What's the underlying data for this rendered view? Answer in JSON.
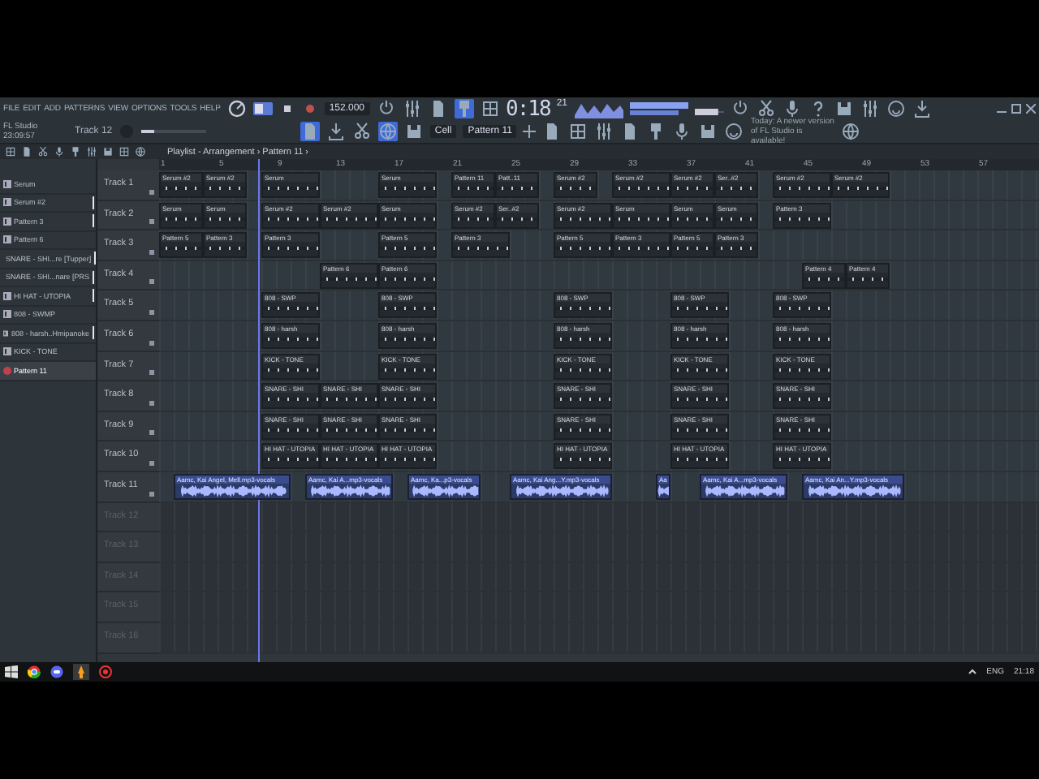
{
  "menu": [
    "FILE",
    "EDIT",
    "ADD",
    "PATTERNS",
    "VIEW",
    "OPTIONS",
    "TOOLS",
    "HELP"
  ],
  "hint": {
    "title": "FL Studio",
    "value": "23:09:57",
    "target": "Track 12"
  },
  "transport": {
    "tempo": "152.000",
    "time": "0:18",
    "time_fraction": "21",
    "pattern": "Pattern 11",
    "snap": "Cell",
    "recording": false,
    "volume": {
      "level": 0.8
    },
    "pitch": {
      "level": 0.2
    }
  },
  "news": "Today: A newer version of FL Studio is available!",
  "playlist": {
    "title": "Playlist - Arrangement › Pattern 11 ›",
    "playhead": {
      "level": 0.112
    },
    "ruler": [
      "1",
      "5",
      "9",
      "13",
      "17",
      "21",
      "25",
      "29",
      "33",
      "37",
      "41",
      "45",
      "49",
      "53",
      "57"
    ],
    "tracks": [
      {
        "name": "Track 1",
        "dimmed": false,
        "clips": [
          {
            "kind": "pattern",
            "label": "Serum #2"
          },
          {
            "kind": "pattern",
            "label": "Serum #2"
          },
          {
            "kind": "pattern",
            "label": "Serum"
          },
          {
            "kind": "pattern",
            "label": "Serum"
          },
          {
            "kind": "pattern",
            "label": "Pattern 11"
          },
          {
            "kind": "pattern",
            "label": "Patt..11"
          },
          {
            "kind": "pattern",
            "label": "Serum #2"
          },
          {
            "kind": "pattern",
            "label": "Serum #2"
          },
          {
            "kind": "pattern",
            "label": "Serum #2"
          },
          {
            "kind": "pattern",
            "label": "Ser..#2"
          },
          {
            "kind": "pattern",
            "label": "Serum #2"
          },
          {
            "kind": "pattern",
            "label": "Serum #2"
          }
        ]
      },
      {
        "name": "Track 2",
        "dimmed": false,
        "clips": [
          {
            "kind": "pattern",
            "label": "Serum"
          },
          {
            "kind": "pattern",
            "label": "Serum"
          },
          {
            "kind": "pattern",
            "label": "Serum #2"
          },
          {
            "kind": "pattern",
            "label": "Serum #2"
          },
          {
            "kind": "pattern",
            "label": "Serum"
          },
          {
            "kind": "pattern",
            "label": "Serum #2"
          },
          {
            "kind": "pattern",
            "label": "Ser..#2"
          },
          {
            "kind": "pattern",
            "label": "Serum #2"
          },
          {
            "kind": "pattern",
            "label": "Serum"
          },
          {
            "kind": "pattern",
            "label": "Serum"
          },
          {
            "kind": "pattern",
            "label": "Serum"
          },
          {
            "kind": "pattern",
            "label": "Pattern 3"
          }
        ]
      },
      {
        "name": "Track 3",
        "dimmed": false,
        "clips": [
          {
            "kind": "pattern",
            "label": "Pattern 5"
          },
          {
            "kind": "pattern",
            "label": "Pattern 3"
          },
          {
            "kind": "pattern",
            "label": "Pattern 3"
          },
          {
            "kind": "pattern",
            "label": "Pattern 5"
          },
          {
            "kind": "pattern",
            "label": "Pattern 3"
          },
          {
            "kind": "pattern",
            "label": "Pattern 5"
          },
          {
            "kind": "pattern",
            "label": "Pattern 3"
          },
          {
            "kind": "pattern",
            "label": "Pattern 5"
          },
          {
            "kind": "pattern",
            "label": "Pattern 3"
          }
        ]
      },
      {
        "name": "Track 4",
        "dimmed": false,
        "clips": [
          {
            "kind": "pattern",
            "label": "Pattern 6"
          },
          {
            "kind": "pattern",
            "label": "Pattern 6"
          },
          {
            "kind": "pattern",
            "label": "Pattern 4"
          },
          {
            "kind": "pattern",
            "label": "Pattern 4"
          }
        ]
      },
      {
        "name": "Track 5",
        "dimmed": false,
        "clips": [
          {
            "kind": "pattern",
            "label": "808 - SWP"
          },
          {
            "kind": "pattern",
            "label": "808 - SWP"
          },
          {
            "kind": "pattern",
            "label": "808 - SWP"
          },
          {
            "kind": "pattern",
            "label": "808 - SWP"
          },
          {
            "kind": "pattern",
            "label": "808 - SWP"
          }
        ]
      },
      {
        "name": "Track 6",
        "dimmed": false,
        "clips": [
          {
            "kind": "pattern",
            "label": "808 - harsh"
          },
          {
            "kind": "pattern",
            "label": "808 - harsh"
          },
          {
            "kind": "pattern",
            "label": "808 - harsh"
          },
          {
            "kind": "pattern",
            "label": "808 - harsh"
          },
          {
            "kind": "pattern",
            "label": "808 - harsh"
          }
        ]
      },
      {
        "name": "Track 7",
        "dimmed": false,
        "clips": [
          {
            "kind": "pattern",
            "label": "KICK - TONE"
          },
          {
            "kind": "pattern",
            "label": "KICK - TONE"
          },
          {
            "kind": "pattern",
            "label": "KICK - TONE"
          },
          {
            "kind": "pattern",
            "label": "KICK - TONE"
          },
          {
            "kind": "pattern",
            "label": "KICK - TONE"
          }
        ]
      },
      {
        "name": "Track 8",
        "dimmed": false,
        "clips": [
          {
            "kind": "pattern",
            "label": "SNARE - SHI"
          },
          {
            "kind": "pattern",
            "label": "SNARE - SHI"
          },
          {
            "kind": "pattern",
            "label": "SNARE - SHI"
          },
          {
            "kind": "pattern",
            "label": "SNARE - SHI"
          },
          {
            "kind": "pattern",
            "label": "SNARE - SHI"
          },
          {
            "kind": "pattern",
            "label": "SNARE - SHI"
          }
        ]
      },
      {
        "name": "Track 9",
        "dimmed": false,
        "clips": [
          {
            "kind": "pattern",
            "label": "SNARE - SHI"
          },
          {
            "kind": "pattern",
            "label": "SNARE - SHI"
          },
          {
            "kind": "pattern",
            "label": "SNARE - SHI"
          },
          {
            "kind": "pattern",
            "label": "SNARE - SHI"
          },
          {
            "kind": "pattern",
            "label": "SNARE - SHI"
          },
          {
            "kind": "pattern",
            "label": "SNARE - SHI"
          }
        ]
      },
      {
        "name": "Track 10",
        "dimmed": false,
        "clips": [
          {
            "kind": "pattern",
            "label": "HI HAT - UTOPIA"
          },
          {
            "kind": "pattern",
            "label": "HI HAT - UTOPIA"
          },
          {
            "kind": "pattern",
            "label": "HI HAT - UTOPIA"
          },
          {
            "kind": "pattern",
            "label": "HI HAT - UTOPIA"
          },
          {
            "kind": "pattern",
            "label": "HI HAT - UTOPIA"
          },
          {
            "kind": "pattern",
            "label": "HI HAT - UTOPIA"
          }
        ]
      },
      {
        "name": "Track 11",
        "dimmed": false,
        "clips": [
          {
            "kind": "audio",
            "label": "Aamc, Kai Angel, Mell.mp3-vocals"
          },
          {
            "kind": "audio",
            "label": "Aamc, Kai A...mp3-vocals"
          },
          {
            "kind": "audio",
            "label": "Aamc, Ka...p3-vocals"
          },
          {
            "kind": "audio",
            "label": "Aamc, Kai Ang...Y.mp3-vocals"
          },
          {
            "kind": "audio",
            "label": "Aa"
          },
          {
            "kind": "audio",
            "label": "Aamc, Kai A...mp3-vocals"
          },
          {
            "kind": "audio",
            "label": "Aamc, Kai An...Y.mp3-vocals"
          }
        ]
      },
      {
        "name": "Track 12",
        "dimmed": true
      },
      {
        "name": "Track 13",
        "dimmed": true
      },
      {
        "name": "Track 14",
        "dimmed": true
      },
      {
        "name": "Track 15",
        "dimmed": true
      },
      {
        "name": "Track 16",
        "dimmed": true
      }
    ]
  },
  "browser": [
    {
      "label": "Serum",
      "selected": false,
      "marked": false
    },
    {
      "label": "Serum #2",
      "selected": false,
      "marked": true
    },
    {
      "label": "Pattern 3",
      "selected": false,
      "marked": true
    },
    {
      "label": "Pattern 6",
      "selected": false,
      "marked": false
    },
    {
      "label": "SNARE - SHI...re [Tupper]",
      "selected": false,
      "marked": true
    },
    {
      "label": "SNARE - SHI...nare [PRS",
      "selected": false,
      "marked": true
    },
    {
      "label": "HI HAT - UTOPIA",
      "selected": false,
      "marked": true
    },
    {
      "label": "808 - SWMP",
      "selected": false,
      "marked": false
    },
    {
      "label": "808 - harsh..Hmipanoke",
      "selected": false,
      "marked": true
    },
    {
      "label": "KICK - TONE",
      "selected": false,
      "marked": false
    },
    {
      "label": "Pattern 11",
      "selected": true,
      "marked": false
    }
  ],
  "taskbar": {
    "language": "ENG",
    "clock": "21:18"
  }
}
